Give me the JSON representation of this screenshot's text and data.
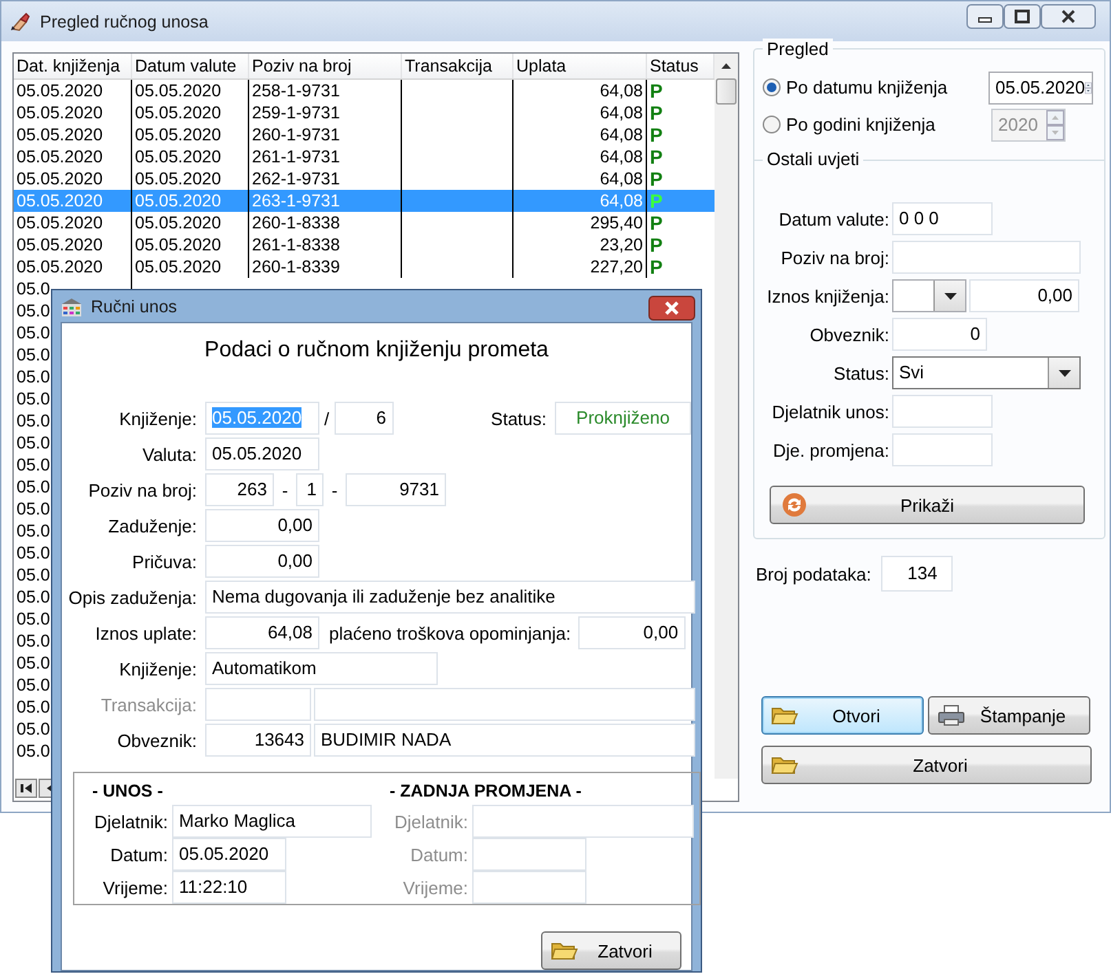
{
  "window": {
    "title": "Pregled ručnog unosa"
  },
  "table": {
    "columns": [
      "Dat. knjiženja",
      "Datum valute",
      "Poziv na broj",
      "Transakcija",
      "Uplata",
      "Status"
    ],
    "rows": [
      {
        "cells": [
          "05.05.2020",
          "05.05.2020",
          "258-1-9731",
          "",
          "64,08",
          "P"
        ],
        "selected": false
      },
      {
        "cells": [
          "05.05.2020",
          "05.05.2020",
          "259-1-9731",
          "",
          "64,08",
          "P"
        ],
        "selected": false
      },
      {
        "cells": [
          "05.05.2020",
          "05.05.2020",
          "260-1-9731",
          "",
          "64,08",
          "P"
        ],
        "selected": false
      },
      {
        "cells": [
          "05.05.2020",
          "05.05.2020",
          "261-1-9731",
          "",
          "64,08",
          "P"
        ],
        "selected": false
      },
      {
        "cells": [
          "05.05.2020",
          "05.05.2020",
          "262-1-9731",
          "",
          "64,08",
          "P"
        ],
        "selected": false
      },
      {
        "cells": [
          "05.05.2020",
          "05.05.2020",
          "263-1-9731",
          "",
          "64,08",
          "P"
        ],
        "selected": true
      },
      {
        "cells": [
          "05.05.2020",
          "05.05.2020",
          "260-1-8338",
          "",
          "295,40",
          "P"
        ],
        "selected": false
      },
      {
        "cells": [
          "05.05.2020",
          "05.05.2020",
          "261-1-8338",
          "",
          "23,20",
          "P"
        ],
        "selected": false
      },
      {
        "cells": [
          "05.05.2020",
          "05.05.2020",
          "260-1-8339",
          "",
          "227,20",
          "P"
        ],
        "selected": false
      },
      {
        "cells": [
          "05.0"
        ],
        "selected": false
      },
      {
        "cells": [
          "05.0"
        ],
        "selected": false
      },
      {
        "cells": [
          "05.0"
        ],
        "selected": false
      },
      {
        "cells": [
          "05.0"
        ],
        "selected": false
      },
      {
        "cells": [
          "05.0"
        ],
        "selected": false
      },
      {
        "cells": [
          "05.0"
        ],
        "selected": false
      },
      {
        "cells": [
          "05.0"
        ],
        "selected": false
      },
      {
        "cells": [
          "05.0"
        ],
        "selected": false
      },
      {
        "cells": [
          "05.0"
        ],
        "selected": false
      },
      {
        "cells": [
          "05.0"
        ],
        "selected": false
      },
      {
        "cells": [
          "05.0"
        ],
        "selected": false
      },
      {
        "cells": [
          "05.0"
        ],
        "selected": false
      },
      {
        "cells": [
          "05.0"
        ],
        "selected": false
      },
      {
        "cells": [
          "05.0"
        ],
        "selected": false
      },
      {
        "cells": [
          "05.0"
        ],
        "selected": false
      },
      {
        "cells": [
          "05.0"
        ],
        "selected": false
      },
      {
        "cells": [
          "05.0"
        ],
        "selected": false
      },
      {
        "cells": [
          "05.0"
        ],
        "selected": false
      },
      {
        "cells": [
          "05.0"
        ],
        "selected": false
      },
      {
        "cells": [
          "05.0"
        ],
        "selected": false
      },
      {
        "cells": [
          "05.0"
        ],
        "selected": false
      },
      {
        "cells": [
          "05.0"
        ],
        "selected": false
      }
    ]
  },
  "pregled": {
    "title": "Pregled",
    "options": [
      {
        "label": "Po datumu knjiženja",
        "selected": true,
        "value": "05.05.2020",
        "disabled": false
      },
      {
        "label": "Po godini knjiženja",
        "selected": false,
        "value": "2020",
        "disabled": true
      }
    ]
  },
  "ostali_uvjeti": {
    "title": "Ostali uvjeti",
    "fields": [
      {
        "kind": "short",
        "label": "Datum valute:",
        "value": "0 0  0"
      },
      {
        "kind": "long",
        "label": "Poziv na broj:"
      },
      {
        "kind": "operator-amount",
        "label": "Iznos knjiženja:",
        "value": "0,00"
      },
      {
        "kind": "number",
        "label": "Obveznik:",
        "value": "0"
      },
      {
        "kind": "dropdown",
        "label": "Status:",
        "value": "Svi"
      },
      {
        "kind": "short",
        "label": "Djelatnik unos:"
      },
      {
        "kind": "short",
        "label": "Dje. promjena:"
      }
    ],
    "button": "Prikaži"
  },
  "count": {
    "label": "Broj podataka:",
    "value": "134"
  },
  "actions": [
    {
      "kind": "open",
      "label": "Otvori",
      "focused": true
    },
    {
      "kind": "print",
      "label": "Štampanje",
      "focused": false
    },
    {
      "kind": "close",
      "label": "Zatvori",
      "focused": false
    }
  ],
  "dialog": {
    "title": "Ručni unos",
    "heading": "Podaci o ručnom knjiženju prometa",
    "knjizenje": {
      "label": "Knjiženje:",
      "date": "05.05.2020",
      "date_selected": true,
      "separator": "/",
      "number": "6"
    },
    "status": {
      "label": "Status:",
      "value": "Proknjiženo"
    },
    "valuta": {
      "label": "Valuta:",
      "value": "05.05.2020"
    },
    "poziv": {
      "label": "Poziv na broj:",
      "parts": [
        "263",
        "1",
        "9731"
      ],
      "separator": "-"
    },
    "zaduzenje": {
      "label": "Zaduženje:",
      "value": "0,00"
    },
    "pricuva": {
      "label": "Pričuva:",
      "value": "0,00"
    },
    "opis": {
      "label": "Opis zaduženja:",
      "value": "Nema dugovanja ili zaduženje bez analitike"
    },
    "iznos": {
      "label": "Iznos uplate:",
      "value": "64,08",
      "extra_label": "plaćeno troškova opominjanja:",
      "extra_value": "0,00"
    },
    "nacin": {
      "label": "Knjiženje:",
      "value": "Automatikom"
    },
    "transakcija": {
      "label": "Transakcija:",
      "disabled": true
    },
    "obveznik": {
      "label": "Obveznik:",
      "code": "13643",
      "name": "BUDIMIR NADA"
    },
    "sections": [
      {
        "title": "- UNOS -",
        "disabled": false,
        "fields": [
          {
            "label": "Djelatnik:",
            "value": "Marko Maglica"
          },
          {
            "label": "Datum:",
            "value": "05.05.2020"
          },
          {
            "label": "Vrijeme:",
            "value": "11:22:10"
          }
        ]
      },
      {
        "title": "- ZADNJA PROMJENA -",
        "disabled": true,
        "fields": [
          {
            "label": "Djelatnik:"
          },
          {
            "label": "Datum:"
          },
          {
            "label": "Vrijeme:"
          }
        ]
      }
    ],
    "button": "Zatvori"
  }
}
